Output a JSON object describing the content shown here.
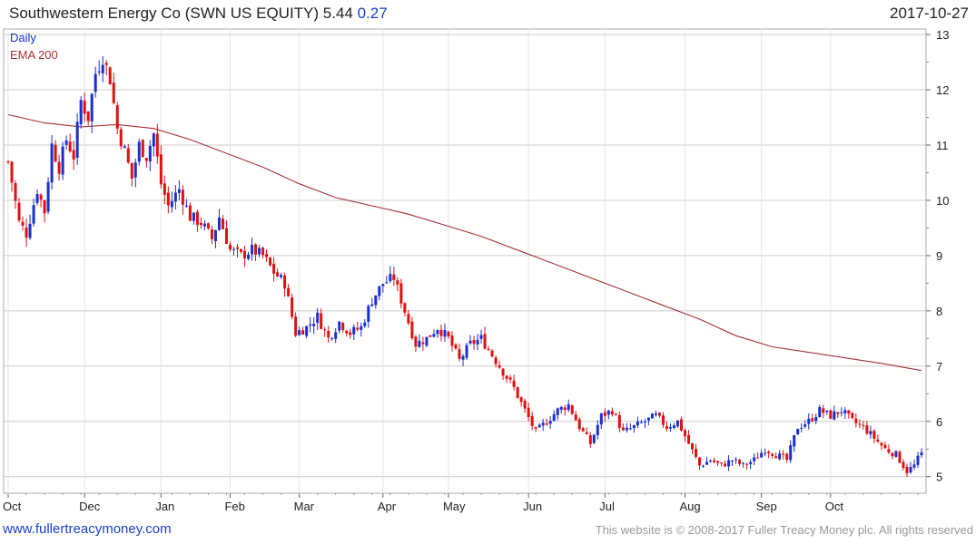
{
  "header": {
    "title": "Southwestern Energy Co (SWN US EQUITY) 5.44",
    "change": "0.27",
    "date": "2017-10-27"
  },
  "footer": {
    "site": "www.fullertreacymoney.com",
    "copyright": "This website is © 2008-2017 Fuller Treacy Money plc. All rights reserved"
  },
  "colors": {
    "up": "#1a2fd0",
    "down": "#e01010",
    "ema": "#a83232",
    "grid": "#cccccc",
    "link": "#1a3fd0"
  },
  "chart_data": {
    "type": "line",
    "title": "Southwestern Energy Co (SWN US EQUITY) 5.44 0.27",
    "legend": [
      "Daily",
      "EMA 200"
    ],
    "legend_placement": "top-left",
    "y_axis_side": "right",
    "ylim": [
      4.7,
      13.1
    ],
    "yticks": [
      5,
      6,
      7,
      8,
      9,
      10,
      11,
      12,
      13
    ],
    "grid": true,
    "x_labels": [
      "Oct",
      "Dec",
      "Jan",
      "Feb",
      "Mar",
      "Apr",
      "May",
      "Jun",
      "Jul",
      "Aug",
      "Sep",
      "Oct"
    ],
    "x_label_days": [
      0,
      21,
      42,
      61,
      80,
      103,
      121,
      143,
      164,
      186,
      207,
      226
    ],
    "days_total": 251,
    "daily_close_anchors": [
      [
        0,
        10.7
      ],
      [
        3,
        9.6
      ],
      [
        5,
        9.4
      ],
      [
        8,
        10.2
      ],
      [
        10,
        9.8
      ],
      [
        12,
        11.0
      ],
      [
        14,
        10.6
      ],
      [
        16,
        11.1
      ],
      [
        18,
        10.8
      ],
      [
        20,
        11.8
      ],
      [
        22,
        11.5
      ],
      [
        24,
        12.3
      ],
      [
        26,
        12.6
      ],
      [
        28,
        12.2
      ],
      [
        30,
        11.3
      ],
      [
        32,
        10.9
      ],
      [
        34,
        10.4
      ],
      [
        36,
        11.0
      ],
      [
        38,
        10.8
      ],
      [
        40,
        11.2
      ],
      [
        42,
        10.3
      ],
      [
        44,
        9.9
      ],
      [
        47,
        10.2
      ],
      [
        50,
        9.7
      ],
      [
        53,
        9.6
      ],
      [
        56,
        9.3
      ],
      [
        58,
        9.7
      ],
      [
        61,
        9.1
      ],
      [
        64,
        9.0
      ],
      [
        67,
        9.1
      ],
      [
        70,
        9.0
      ],
      [
        73,
        8.7
      ],
      [
        76,
        8.5
      ],
      [
        79,
        7.6
      ],
      [
        82,
        7.7
      ],
      [
        85,
        7.9
      ],
      [
        88,
        7.5
      ],
      [
        91,
        7.8
      ],
      [
        94,
        7.6
      ],
      [
        97,
        7.7
      ],
      [
        100,
        8.2
      ],
      [
        103,
        8.5
      ],
      [
        106,
        8.6
      ],
      [
        109,
        8.0
      ],
      [
        112,
        7.4
      ],
      [
        115,
        7.5
      ],
      [
        118,
        7.7
      ],
      [
        121,
        7.5
      ],
      [
        124,
        7.1
      ],
      [
        127,
        7.4
      ],
      [
        130,
        7.5
      ],
      [
        133,
        7.2
      ],
      [
        136,
        6.9
      ],
      [
        139,
        6.6
      ],
      [
        142,
        6.2
      ],
      [
        145,
        5.8
      ],
      [
        148,
        6.0
      ],
      [
        151,
        6.2
      ],
      [
        154,
        6.3
      ],
      [
        157,
        5.9
      ],
      [
        160,
        5.6
      ],
      [
        163,
        6.1
      ],
      [
        166,
        6.2
      ],
      [
        169,
        5.8
      ],
      [
        172,
        5.9
      ],
      [
        175,
        6.0
      ],
      [
        178,
        6.1
      ],
      [
        181,
        5.9
      ],
      [
        184,
        6.0
      ],
      [
        187,
        5.6
      ],
      [
        190,
        5.2
      ],
      [
        193,
        5.3
      ],
      [
        196,
        5.2
      ],
      [
        199,
        5.3
      ],
      [
        202,
        5.2
      ],
      [
        205,
        5.3
      ],
      [
        208,
        5.5
      ],
      [
        211,
        5.4
      ],
      [
        214,
        5.3
      ],
      [
        217,
        5.9
      ],
      [
        220,
        6.0
      ],
      [
        223,
        6.2
      ],
      [
        226,
        6.1
      ],
      [
        229,
        6.2
      ],
      [
        232,
        6.0
      ],
      [
        235,
        5.9
      ],
      [
        238,
        5.7
      ],
      [
        241,
        5.5
      ],
      [
        244,
        5.4
      ],
      [
        247,
        5.1
      ],
      [
        249,
        5.2
      ],
      [
        251,
        5.44
      ]
    ],
    "ema200_anchors": [
      [
        0,
        11.55
      ],
      [
        10,
        11.4
      ],
      [
        20,
        11.33
      ],
      [
        30,
        11.37
      ],
      [
        40,
        11.3
      ],
      [
        50,
        11.1
      ],
      [
        60,
        10.85
      ],
      [
        70,
        10.6
      ],
      [
        80,
        10.3
      ],
      [
        90,
        10.05
      ],
      [
        100,
        9.9
      ],
      [
        110,
        9.75
      ],
      [
        120,
        9.55
      ],
      [
        130,
        9.35
      ],
      [
        140,
        9.1
      ],
      [
        150,
        8.85
      ],
      [
        160,
        8.6
      ],
      [
        170,
        8.35
      ],
      [
        180,
        8.1
      ],
      [
        190,
        7.85
      ],
      [
        200,
        7.55
      ],
      [
        210,
        7.35
      ],
      [
        220,
        7.25
      ],
      [
        230,
        7.15
      ],
      [
        240,
        7.05
      ],
      [
        251,
        6.92
      ]
    ]
  }
}
